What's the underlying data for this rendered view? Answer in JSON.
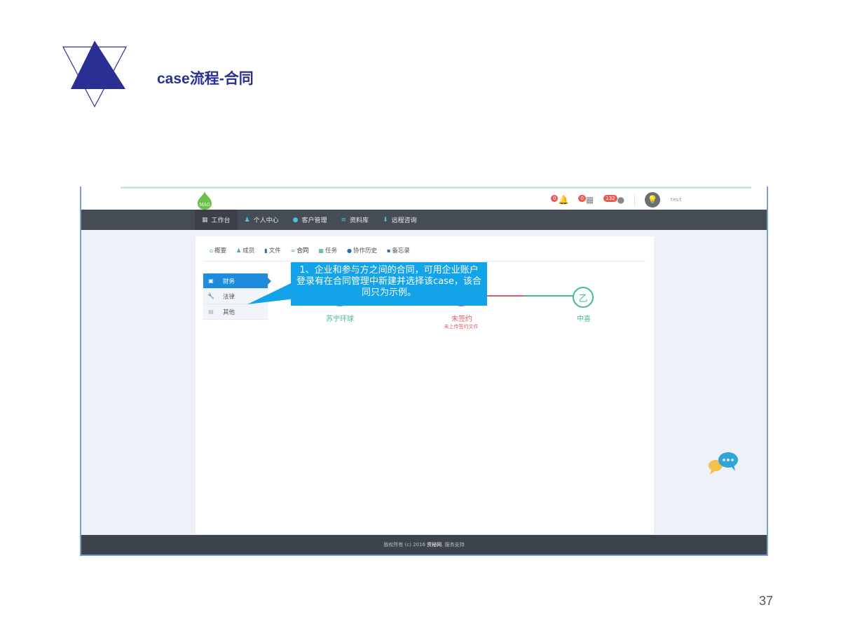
{
  "slide": {
    "title": "case流程-合同",
    "page_number": "37"
  },
  "app": {
    "logo_text": "MAG",
    "notifications": {
      "bell_count": "0",
      "calendar_count": "0",
      "message_count": "132"
    },
    "username": "test",
    "nav": [
      {
        "label": "工作台",
        "icon": "grid-icon"
      },
      {
        "label": "个人中心",
        "icon": "user-icon"
      },
      {
        "label": "客户管理",
        "icon": "chat-icon"
      },
      {
        "label": "资料库",
        "icon": "database-icon"
      },
      {
        "label": "远程咨询",
        "icon": "download-icon"
      }
    ],
    "tabs": [
      {
        "label": "概要",
        "icon": "home-icon"
      },
      {
        "label": "成员",
        "icon": "user-icon"
      },
      {
        "label": "文件",
        "icon": "file-icon"
      },
      {
        "label": "合同",
        "icon": "link-icon"
      },
      {
        "label": "任务",
        "icon": "calendar-icon"
      },
      {
        "label": "协作历史",
        "icon": "chat-icon"
      },
      {
        "label": "备忘录",
        "icon": "note-icon"
      }
    ],
    "side_menu": [
      {
        "label": "财务",
        "icon": "money-icon"
      },
      {
        "label": "法律",
        "icon": "wrench-icon"
      },
      {
        "label": "其他",
        "icon": "folder-icon"
      }
    ],
    "flow": {
      "party_a": "苏宁环球",
      "status": "未签约",
      "status_sub": "未上传签约文件",
      "party_b_mark": "乙",
      "party_b": "中喜"
    },
    "callout": "1、企业和参与方之间的合同，可用企业账户登录有在合同管理中新建并选择该case，该合同只为示例。",
    "footer": {
      "prefix": "版权所有 (c) 2016",
      "brand": "资秘网",
      "suffix": ". 服务支持"
    }
  },
  "colors": {
    "title": "#2b2f94",
    "navbar": "#464c56",
    "accent": "#1e8bdc",
    "callout": "#12a3e8",
    "green": "#3fbf8a",
    "red": "#e55b66"
  }
}
